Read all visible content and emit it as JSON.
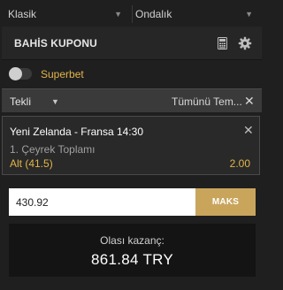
{
  "top_selects": {
    "bet_type": {
      "value": "Klasik",
      "icon": "chevron-down-icon"
    },
    "odds_format": {
      "value": "Ondalık",
      "icon": "chevron-down-icon"
    }
  },
  "slip": {
    "title": "BAHİS KUPONU",
    "icons": [
      "calculator-icon",
      "gear-icon"
    ]
  },
  "superbet": {
    "label": "Superbet",
    "enabled": false
  },
  "single_bar": {
    "label": "Tekli",
    "clear_label": "Tümünü Tem...",
    "clear_icon": "close-icon"
  },
  "bet": {
    "match": "Yeni Zelanda - Fransa 14:30",
    "market": "1. Çeyrek Toplamı",
    "selection": "Alt (41.5)",
    "odds": "2.00"
  },
  "stake": {
    "value": "430.92",
    "max_label": "MAKS"
  },
  "winnings": {
    "label": "Olası kazanç:",
    "amount": "861.84 TRY"
  },
  "colors": {
    "accent": "#e3b54a",
    "button": "#c9a55c",
    "background": "#1f1f1f"
  }
}
